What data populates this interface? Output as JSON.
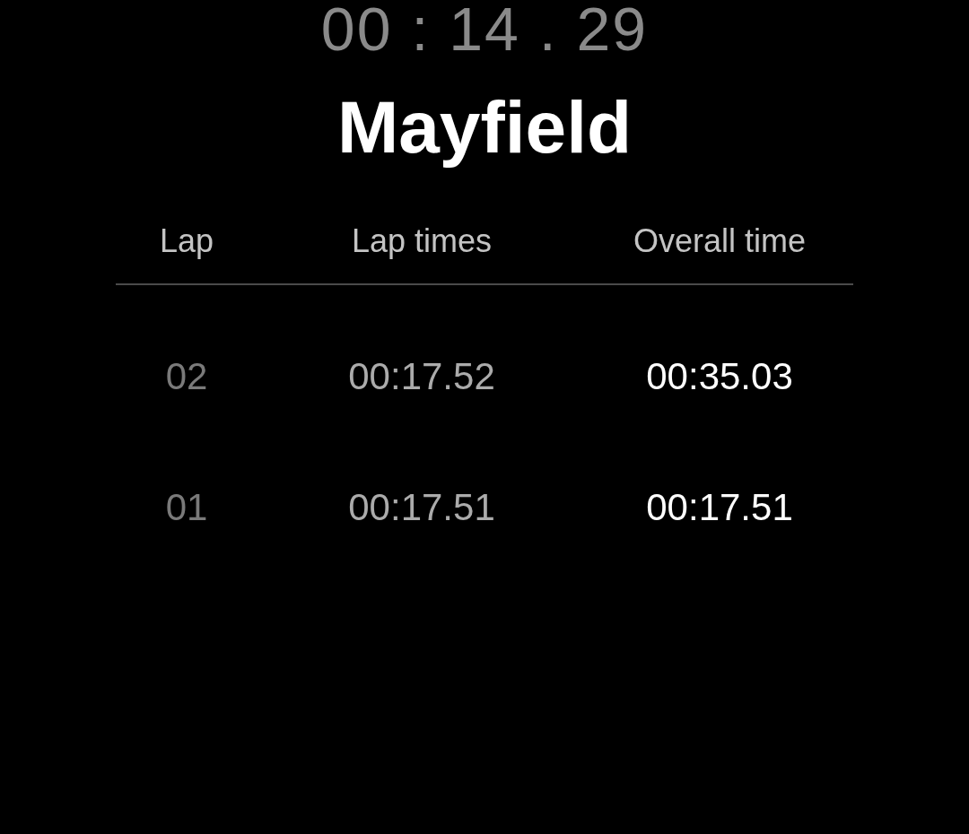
{
  "timer": "00 : 14 . 29",
  "title": "Mayfield",
  "columns": [
    "Lap",
    "Lap times",
    "Overall time"
  ],
  "laps": [
    {
      "lap": "02",
      "lap_time": "00:17.52",
      "overall_time": "00:35.03"
    },
    {
      "lap": "01",
      "lap_time": "00:17.51",
      "overall_time": "00:17.51"
    }
  ]
}
